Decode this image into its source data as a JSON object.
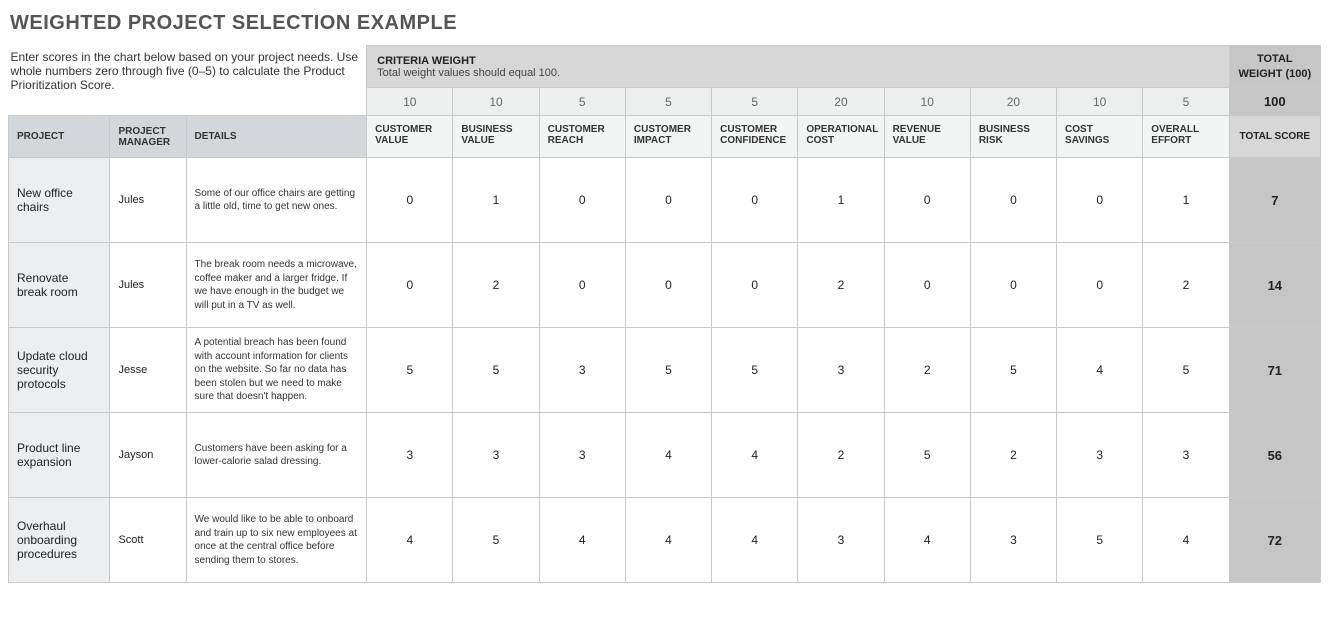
{
  "title": "WEIGHTED PROJECT SELECTION EXAMPLE",
  "instructions": "Enter scores in the chart below based on your project needs. Use whole numbers zero through five (0–5) to calculate the Product Prioritization Score.",
  "criteria_weight": {
    "label": "CRITERIA WEIGHT",
    "sub": "Total weight values should equal 100."
  },
  "total_weight_label": "TOTAL WEIGHT (100)",
  "weights": [
    "10",
    "10",
    "5",
    "5",
    "5",
    "20",
    "10",
    "20",
    "10",
    "5"
  ],
  "weight_sum": "100",
  "headers": {
    "project": "PROJECT",
    "manager": "PROJECT MANAGER",
    "details": "DETAILS",
    "criteria": [
      "CUSTOMER VALUE",
      "BUSINESS VALUE",
      "CUSTOMER REACH",
      "CUSTOMER IMPACT",
      "CUSTOMER CONFIDENCE",
      "OPERATIONAL COST",
      "REVENUE VALUE",
      "BUSINESS RISK",
      "COST SAVINGS",
      "OVERALL EFFORT"
    ],
    "total": "TOTAL SCORE"
  },
  "rows": [
    {
      "project": "New office chairs",
      "manager": "Jules",
      "details": "Some of our office chairs are getting a little old, time to get new ones.",
      "scores": [
        "0",
        "1",
        "0",
        "0",
        "0",
        "1",
        "0",
        "0",
        "0",
        "1"
      ],
      "total": "7"
    },
    {
      "project": "Renovate break room",
      "manager": "Jules",
      "details": "The break room needs a microwave, coffee maker and a larger fridge. If we have enough in the budget we will put in a TV as well.",
      "scores": [
        "0",
        "2",
        "0",
        "0",
        "0",
        "2",
        "0",
        "0",
        "0",
        "2"
      ],
      "total": "14"
    },
    {
      "project": "Update cloud security protocols",
      "manager": "Jesse",
      "details": "A potential breach has been found with account information for clients on the website. So far no data has been stolen but we need to make sure that doesn't happen.",
      "scores": [
        "5",
        "5",
        "3",
        "5",
        "5",
        "3",
        "2",
        "5",
        "4",
        "5"
      ],
      "total": "71"
    },
    {
      "project": "Product line expansion",
      "manager": "Jayson",
      "details": "Customers have been asking for a lower-calorie salad dressing.",
      "scores": [
        "3",
        "3",
        "3",
        "4",
        "4",
        "2",
        "5",
        "2",
        "3",
        "3"
      ],
      "total": "56"
    },
    {
      "project": "Overhaul onboarding procedures",
      "manager": "Scott",
      "details": "We would like to be able to onboard and train up to six new employees at once at the central office before sending them to stores.",
      "scores": [
        "4",
        "5",
        "4",
        "4",
        "4",
        "3",
        "4",
        "3",
        "5",
        "4"
      ],
      "total": "72"
    }
  ]
}
